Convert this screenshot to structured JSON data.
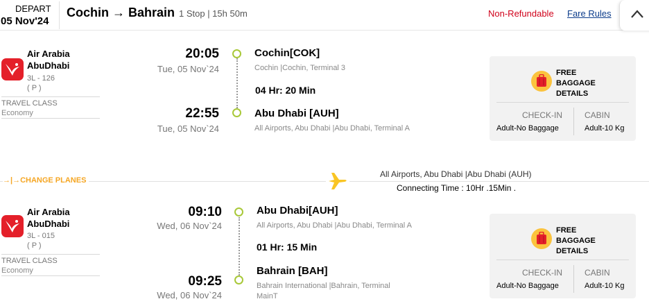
{
  "header": {
    "depart_label": "DEPART",
    "depart_date": "05 Nov'24",
    "from_city": "Cochin",
    "to_city": "Bahrain",
    "meta": "1 Stop | 15h 50m",
    "refund_status": "Non-Refundable",
    "fare_rules": "Fare Rules",
    "colors": {
      "refund": "#d0021b",
      "link": "#0c3c8b"
    }
  },
  "segments": [
    {
      "airline_line1": "Air Arabia",
      "airline_line2": "AbuDhabi",
      "flight_no": "3L - 126",
      "fare_class": "( P )",
      "travel_class_label": "TRAVEL CLASS",
      "travel_class": "Economy",
      "dep_time": "20:05",
      "dep_day": "Tue, 05 Nov`24",
      "dep_city": "Cochin[COK]",
      "dep_airport": "Cochin |Cochin, Terminal 3",
      "duration": "04 Hr: 20 Min",
      "arr_time": "22:55",
      "arr_day": "Tue, 05 Nov`24",
      "arr_city": "Abu Dhabi [AUH]",
      "arr_airport": "All Airports, Abu Dhabi |Abu Dhabi, Terminal A",
      "baggage": {
        "title_l1": "FREE",
        "title_l2": "BAGGAGE",
        "title_l3": "DETAILS",
        "checkin_label": "CHECK-IN",
        "cabin_label": "CABIN",
        "checkin_value": "Adult-No Baggage",
        "cabin_value": "Adult-10 Kg"
      }
    },
    {
      "airline_line1": "Air Arabia",
      "airline_line2": "AbuDhabi",
      "flight_no": "3L - 015",
      "fare_class": "( P )",
      "travel_class_label": "TRAVEL CLASS",
      "travel_class": "Economy",
      "dep_time": "09:10",
      "dep_day": "Wed, 06 Nov`24",
      "dep_city": "Abu Dhabi[AUH]",
      "dep_airport": "All Airports, Abu Dhabi |Abu Dhabi, Terminal A",
      "duration": "01 Hr: 15 Min",
      "arr_time": "09:25",
      "arr_day": "Wed, 06 Nov`24",
      "arr_city": "Bahrain [BAH]",
      "arr_airport_l1": "Bahrain International |Bahrain, Terminal",
      "arr_airport_l2": "MainT",
      "baggage": {
        "title_l1": "FREE",
        "title_l2": "BAGGAGE",
        "title_l3": "DETAILS",
        "checkin_label": "CHECK-IN",
        "cabin_label": "CABIN",
        "checkin_value": "Adult-No Baggage",
        "cabin_value": "Adult-10 Kg"
      }
    }
  ],
  "layover": {
    "change_planes": "CHANGE PLANES",
    "airport": "All Airports, Abu Dhabi |Abu Dhabi (AUH)",
    "connecting": "Connecting Time : 10Hr .15Min ."
  }
}
